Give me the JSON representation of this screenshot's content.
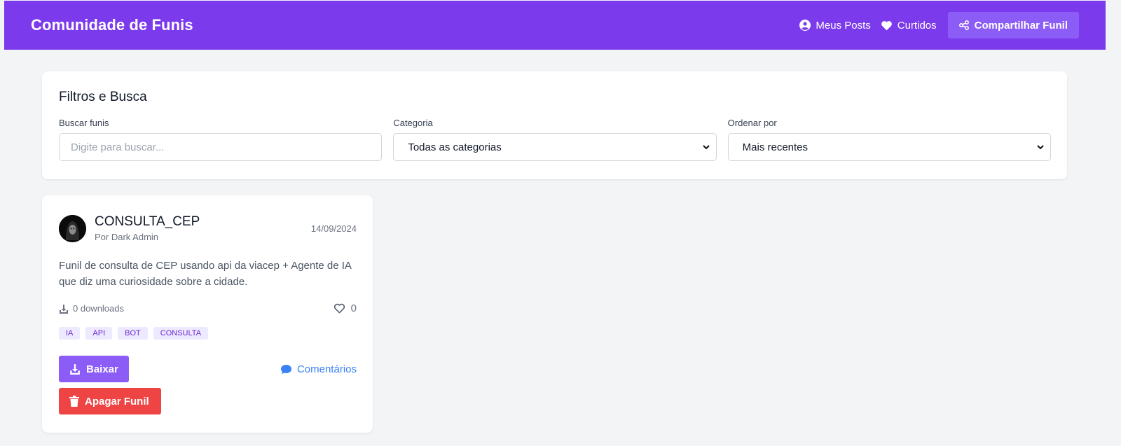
{
  "header": {
    "brand": "Comunidade de Funis",
    "my_posts": "Meus Posts",
    "liked": "Curtidos",
    "share": "Compartilhar Funil",
    "bg_color": "#7c3aed"
  },
  "filters": {
    "title": "Filtros e Busca",
    "search_label": "Buscar funis",
    "search_placeholder": "Digite para buscar...",
    "category_label": "Categoria",
    "category_value": "Todas as categorias",
    "order_label": "Ordenar por",
    "order_value": "Mais recentes"
  },
  "post": {
    "title": "CONSULTA_CEP",
    "author": "Por Dark Admin",
    "date": "14/09/2024",
    "description": "Funil de consulta de CEP usando api da viacep + Agente de IA que diz uma curiosidade sobre a cidade.",
    "downloads": "0 downloads",
    "likes": "0",
    "tags": [
      "IA",
      "API",
      "BOT",
      "CONSULTA"
    ],
    "download_button": "Baixar",
    "comments_link": "Comentários",
    "delete_button": "Apagar Funil",
    "accent_color": "#8b5cf6",
    "danger_color": "#ef4444",
    "link_color": "#3b82f6"
  }
}
